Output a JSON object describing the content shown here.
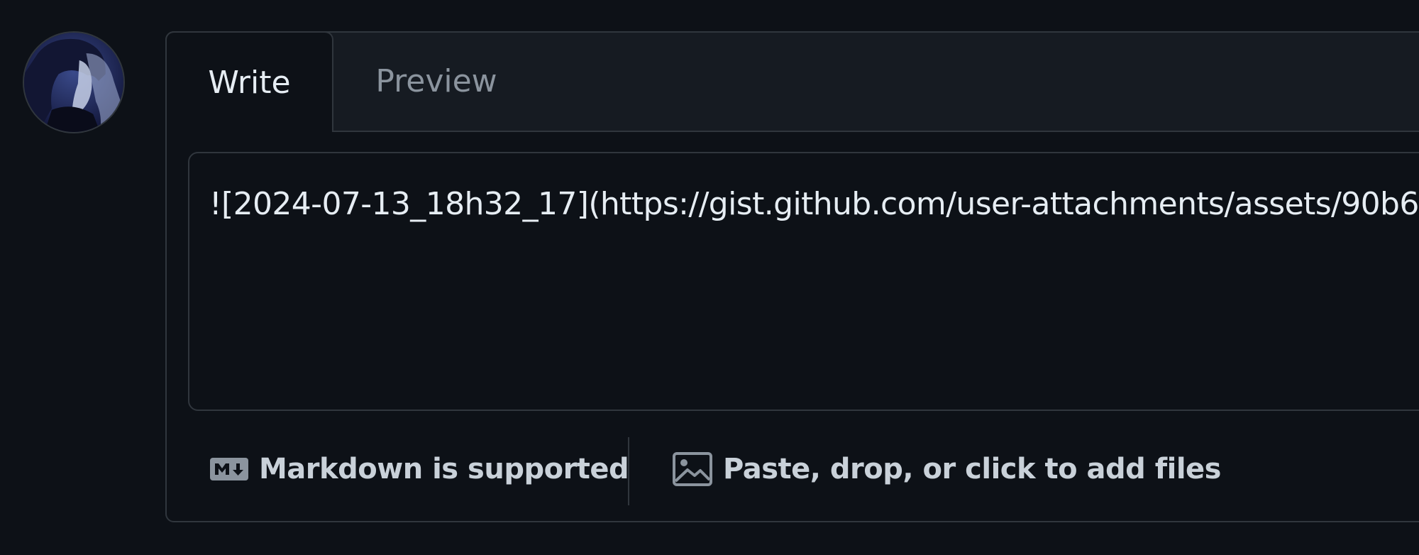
{
  "avatar": {
    "alt": "User avatar"
  },
  "tabs": {
    "write": "Write",
    "preview": "Preview"
  },
  "editor": {
    "value": "![2024-07-13_18h32_17](https://gist.github.com/user-attachments/assets/90b6"
  },
  "footer": {
    "markdown_label": "Markdown is supported",
    "markdown_icon": "markdown-icon",
    "files_label": "Paste, drop, or click to add files",
    "files_icon": "image-icon"
  },
  "colors": {
    "background": "#0d1117",
    "tabbar": "#161b22",
    "border": "#30363d",
    "text": "#e6edf3",
    "muted": "#8b949e"
  }
}
